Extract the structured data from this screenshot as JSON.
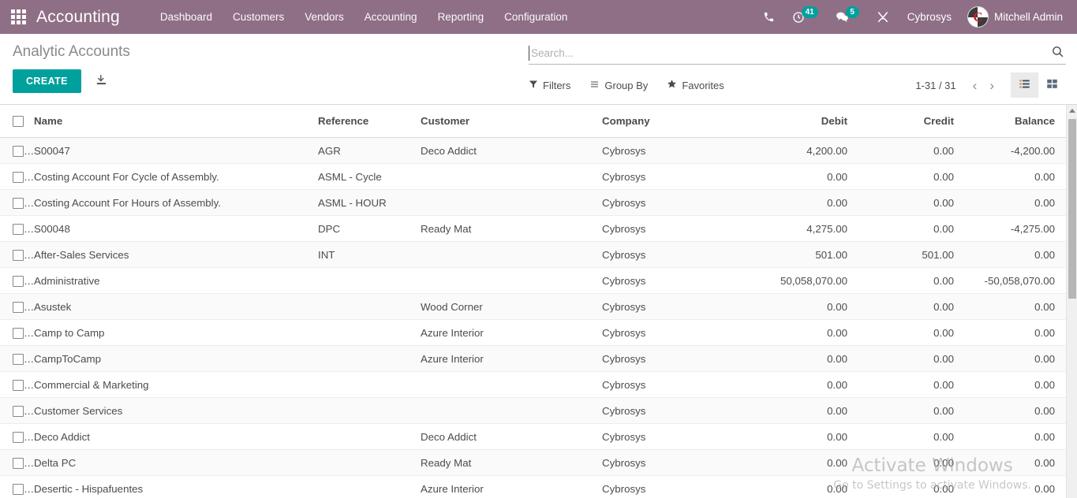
{
  "navbar": {
    "apps_icon": "apps-grid-icon",
    "brand": "Accounting",
    "menu": [
      {
        "label": "Dashboard"
      },
      {
        "label": "Customers"
      },
      {
        "label": "Vendors"
      },
      {
        "label": "Accounting"
      },
      {
        "label": "Reporting"
      },
      {
        "label": "Configuration"
      }
    ],
    "systray": {
      "phone_icon": "phone-icon",
      "activity_icon": "clock-activity-icon",
      "activity_count": "41",
      "messaging_icon": "chat-bubble-icon",
      "messaging_count": "5",
      "debug_icon": "wrench-tools-icon",
      "company": "Cybrosys",
      "avatar_icon": "user-avatar",
      "username": "Mitchell Admin"
    },
    "accent": "#8f6f85",
    "badge_color": "#00a09d"
  },
  "control_panel": {
    "breadcrumb": "Analytic Accounts",
    "create_label": "CREATE",
    "create_color": "#00a09d",
    "import_icon": "import-download-icon",
    "search": {
      "placeholder": "Search...",
      "value": "",
      "search_icon": "search-icon"
    },
    "tools": [
      {
        "label": "Filters",
        "icon": "filter-funnel-icon"
      },
      {
        "label": "Group By",
        "icon": "group-by-lines-icon"
      },
      {
        "label": "Favorites",
        "icon": "star-icon"
      }
    ],
    "pager": {
      "range": "1-31 / 31",
      "prev_icon": "chevron-left-icon",
      "prev_label": "‹",
      "next_icon": "chevron-right-icon",
      "next_label": "›"
    },
    "views": [
      {
        "name": "list-view",
        "icon": "list-view-icon",
        "active": true
      },
      {
        "name": "kanban-view",
        "icon": "kanban-grid-icon",
        "active": false
      }
    ]
  },
  "table": {
    "columns": [
      {
        "label": "Name",
        "align": "left"
      },
      {
        "label": "Reference",
        "align": "left"
      },
      {
        "label": "Customer",
        "align": "left"
      },
      {
        "label": "Company",
        "align": "left"
      },
      {
        "label": "Debit",
        "align": "right"
      },
      {
        "label": "Credit",
        "align": "right"
      },
      {
        "label": "Balance",
        "align": "right"
      }
    ],
    "rows": [
      {
        "name": "S00047",
        "reference": "AGR",
        "customer": "Deco Addict",
        "company": "Cybrosys",
        "debit": "4,200.00",
        "credit": "0.00",
        "balance": "-4,200.00"
      },
      {
        "name": "Costing Account For Cycle of Assembly.",
        "reference": "ASML - Cycle",
        "customer": "",
        "company": "Cybrosys",
        "debit": "0.00",
        "credit": "0.00",
        "balance": "0.00"
      },
      {
        "name": "Costing Account For Hours of Assembly.",
        "reference": "ASML - HOUR",
        "customer": "",
        "company": "Cybrosys",
        "debit": "0.00",
        "credit": "0.00",
        "balance": "0.00"
      },
      {
        "name": "S00048",
        "reference": "DPC",
        "customer": "Ready Mat",
        "company": "Cybrosys",
        "debit": "4,275.00",
        "credit": "0.00",
        "balance": "-4,275.00"
      },
      {
        "name": "After-Sales Services",
        "reference": "INT",
        "customer": "",
        "company": "Cybrosys",
        "debit": "501.00",
        "credit": "501.00",
        "balance": "0.00"
      },
      {
        "name": "Administrative",
        "reference": "",
        "customer": "",
        "company": "Cybrosys",
        "debit": "50,058,070.00",
        "credit": "0.00",
        "balance": "-50,058,070.00"
      },
      {
        "name": "Asustek",
        "reference": "",
        "customer": "Wood Corner",
        "company": "Cybrosys",
        "debit": "0.00",
        "credit": "0.00",
        "balance": "0.00"
      },
      {
        "name": "Camp to Camp",
        "reference": "",
        "customer": "Azure Interior",
        "company": "Cybrosys",
        "debit": "0.00",
        "credit": "0.00",
        "balance": "0.00"
      },
      {
        "name": "CampToCamp",
        "reference": "",
        "customer": "Azure Interior",
        "company": "Cybrosys",
        "debit": "0.00",
        "credit": "0.00",
        "balance": "0.00"
      },
      {
        "name": "Commercial & Marketing",
        "reference": "",
        "customer": "",
        "company": "Cybrosys",
        "debit": "0.00",
        "credit": "0.00",
        "balance": "0.00"
      },
      {
        "name": "Customer Services",
        "reference": "",
        "customer": "",
        "company": "Cybrosys",
        "debit": "0.00",
        "credit": "0.00",
        "balance": "0.00"
      },
      {
        "name": "Deco Addict",
        "reference": "",
        "customer": "Deco Addict",
        "company": "Cybrosys",
        "debit": "0.00",
        "credit": "0.00",
        "balance": "0.00"
      },
      {
        "name": "Delta PC",
        "reference": "",
        "customer": "Ready Mat",
        "company": "Cybrosys",
        "debit": "0.00",
        "credit": "0.00",
        "balance": "0.00"
      },
      {
        "name": "Desertic - Hispafuentes",
        "reference": "",
        "customer": "Azure Interior",
        "company": "Cybrosys",
        "debit": "0.00",
        "credit": "0.00",
        "balance": "0.00"
      }
    ]
  },
  "watermark": {
    "line1": "Activate Windows",
    "line2": "Go to Settings to activate Windows."
  }
}
